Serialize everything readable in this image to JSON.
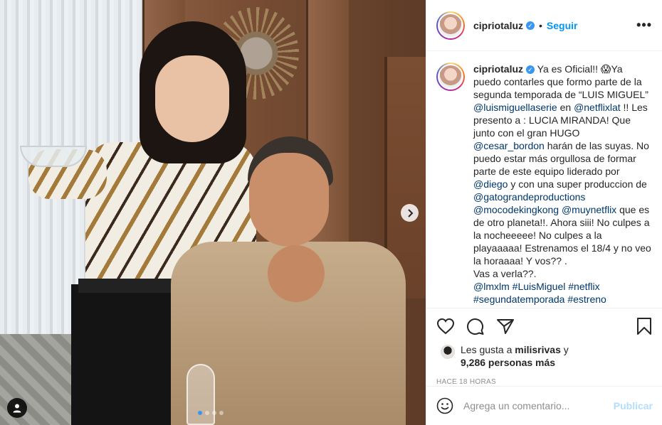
{
  "post": {
    "username": "cipriotaluz",
    "follow_label": "Seguir",
    "more_label": "•••",
    "separator": "•",
    "verified_mark": "✓",
    "carousel": {
      "current": 1,
      "total": 4
    }
  },
  "caption": {
    "username": "cipriotaluz",
    "segments": [
      {
        "text": " Ya es Oficial!! 😱Ya puedo contarles que formo parte de la segunda temporada de “LUIS MIGUEL” ",
        "link": false
      },
      {
        "text": "@luismiguellaserie",
        "link": true
      },
      {
        "text": " en ",
        "link": false
      },
      {
        "text": "@netflixlat",
        "link": true
      },
      {
        "text": " !! Les presento a : LUCIA MIRANDA! Que junto con el gran HUGO ",
        "link": false
      },
      {
        "text": "@cesar_bordon",
        "link": true
      },
      {
        "text": " harán de las suyas. No puedo estar más orgullosa de formar parte de este equipo liderado por ",
        "link": false
      },
      {
        "text": "@diego",
        "link": true
      },
      {
        "text": " y con una super produccion de ",
        "link": false
      },
      {
        "text": "@gatograndeproductions",
        "link": true
      },
      {
        "text": " ",
        "link": false
      },
      {
        "text": "@mocodekingkong",
        "link": true
      },
      {
        "text": " ",
        "link": false
      },
      {
        "text": "@muynetflix",
        "link": true
      },
      {
        "text": " que es de otro planeta!!. Ahora siii! No culpes a la nocheeeee! No culpes a la playaaaaa! Estrenamos el 18/4 y no veo la horaaaa! Y vos?? .",
        "link": false
      },
      {
        "text": "\nVas a verla??.\n",
        "link": false
      },
      {
        "text": "@lmxlm",
        "link": true
      },
      {
        "text": " ",
        "link": false
      },
      {
        "text": "#LuisMiguel",
        "link": true
      },
      {
        "text": " ",
        "link": false
      },
      {
        "text": "#netflix",
        "link": true
      },
      {
        "text": " ",
        "link": false
      },
      {
        "text": "#segundatemporada",
        "link": true
      },
      {
        "text": " ",
        "link": false
      },
      {
        "text": "#estreno",
        "link": true
      }
    ]
  },
  "likes": {
    "prefix": "Les gusta a ",
    "user": "milisrivas",
    "middle": " y",
    "count_text": "9,286 personas más"
  },
  "timestamp": "HACE 18 HORAS",
  "comment": {
    "placeholder": "Agrega un comentario...",
    "publish_label": "Publicar"
  },
  "colors": {
    "link": "#00376b",
    "follow": "#0095f6",
    "publish_disabled": "#b2dffc",
    "carousel_active_dot": "#3897f0"
  }
}
